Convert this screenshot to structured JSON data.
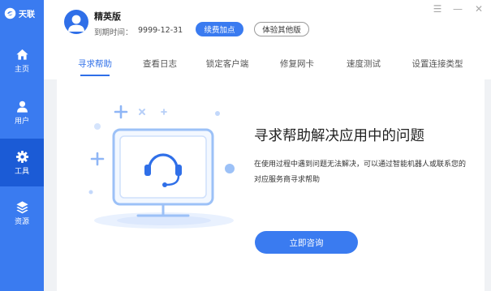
{
  "app": {
    "logo_text": "天联"
  },
  "sidebar": {
    "items": [
      {
        "label": "主页",
        "icon": "home-icon"
      },
      {
        "label": "用户",
        "icon": "user-icon"
      },
      {
        "label": "工具",
        "icon": "gear-icon",
        "active": true
      },
      {
        "label": "资源",
        "icon": "layers-icon"
      }
    ]
  },
  "account": {
    "edition": "精英版",
    "expiry_label": "到期时间：",
    "expiry_value": "9999-12-31",
    "renew_label": "续费加点",
    "other_label": "体验其他版"
  },
  "window_controls": {
    "menu": "☰",
    "minimize": "—",
    "close": "✕"
  },
  "tabs": [
    {
      "label": "寻求帮助",
      "active": true
    },
    {
      "label": "查看日志"
    },
    {
      "label": "锁定客户端"
    },
    {
      "label": "修复网卡"
    },
    {
      "label": "速度测试"
    },
    {
      "label": "设置连接类型"
    }
  ],
  "help": {
    "title": "寻求帮助解决应用中的问题",
    "description": "在使用过程中遇到问题无法解决，可以通过智能机器人或联系您的对应服务商寻求帮助",
    "button_label": "立即咨询"
  },
  "colors": {
    "brand": "#3a7bf0",
    "sidebar_active": "#1b5bd6",
    "accent_text": "#2f6fe8",
    "content_bg": "#f0f2f5"
  }
}
